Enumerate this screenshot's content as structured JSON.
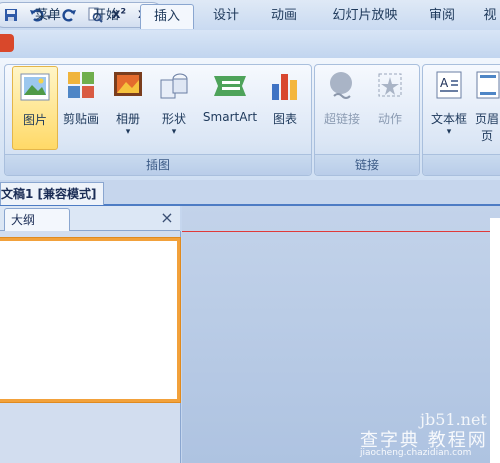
{
  "tabs": [
    "菜单",
    "开始",
    "插入",
    "设计",
    "动画",
    "幻灯片放映",
    "审阅",
    "视"
  ],
  "active_tab": "插入",
  "qat": {
    "superscript": "x²",
    "subscript": "x₁"
  },
  "ribbon": {
    "groups": [
      {
        "label": "插图",
        "buttons": [
          "图片",
          "剪贴画",
          "相册",
          "形状",
          "SmartArt",
          "图表"
        ]
      },
      {
        "label": "链接",
        "buttons": [
          "超链接",
          "动作"
        ]
      },
      {
        "label": "",
        "buttons": [
          "文本框",
          "页眉",
          "页"
        ]
      }
    ]
  },
  "document_tab": "文稿1 [兼容模式]",
  "outline_tab": "大纲",
  "close_glyph": "×",
  "watermark": {
    "line1": "jb51.net",
    "line2": "查字典 教程网",
    "line3": "jiaocheng.chazidian.com"
  }
}
